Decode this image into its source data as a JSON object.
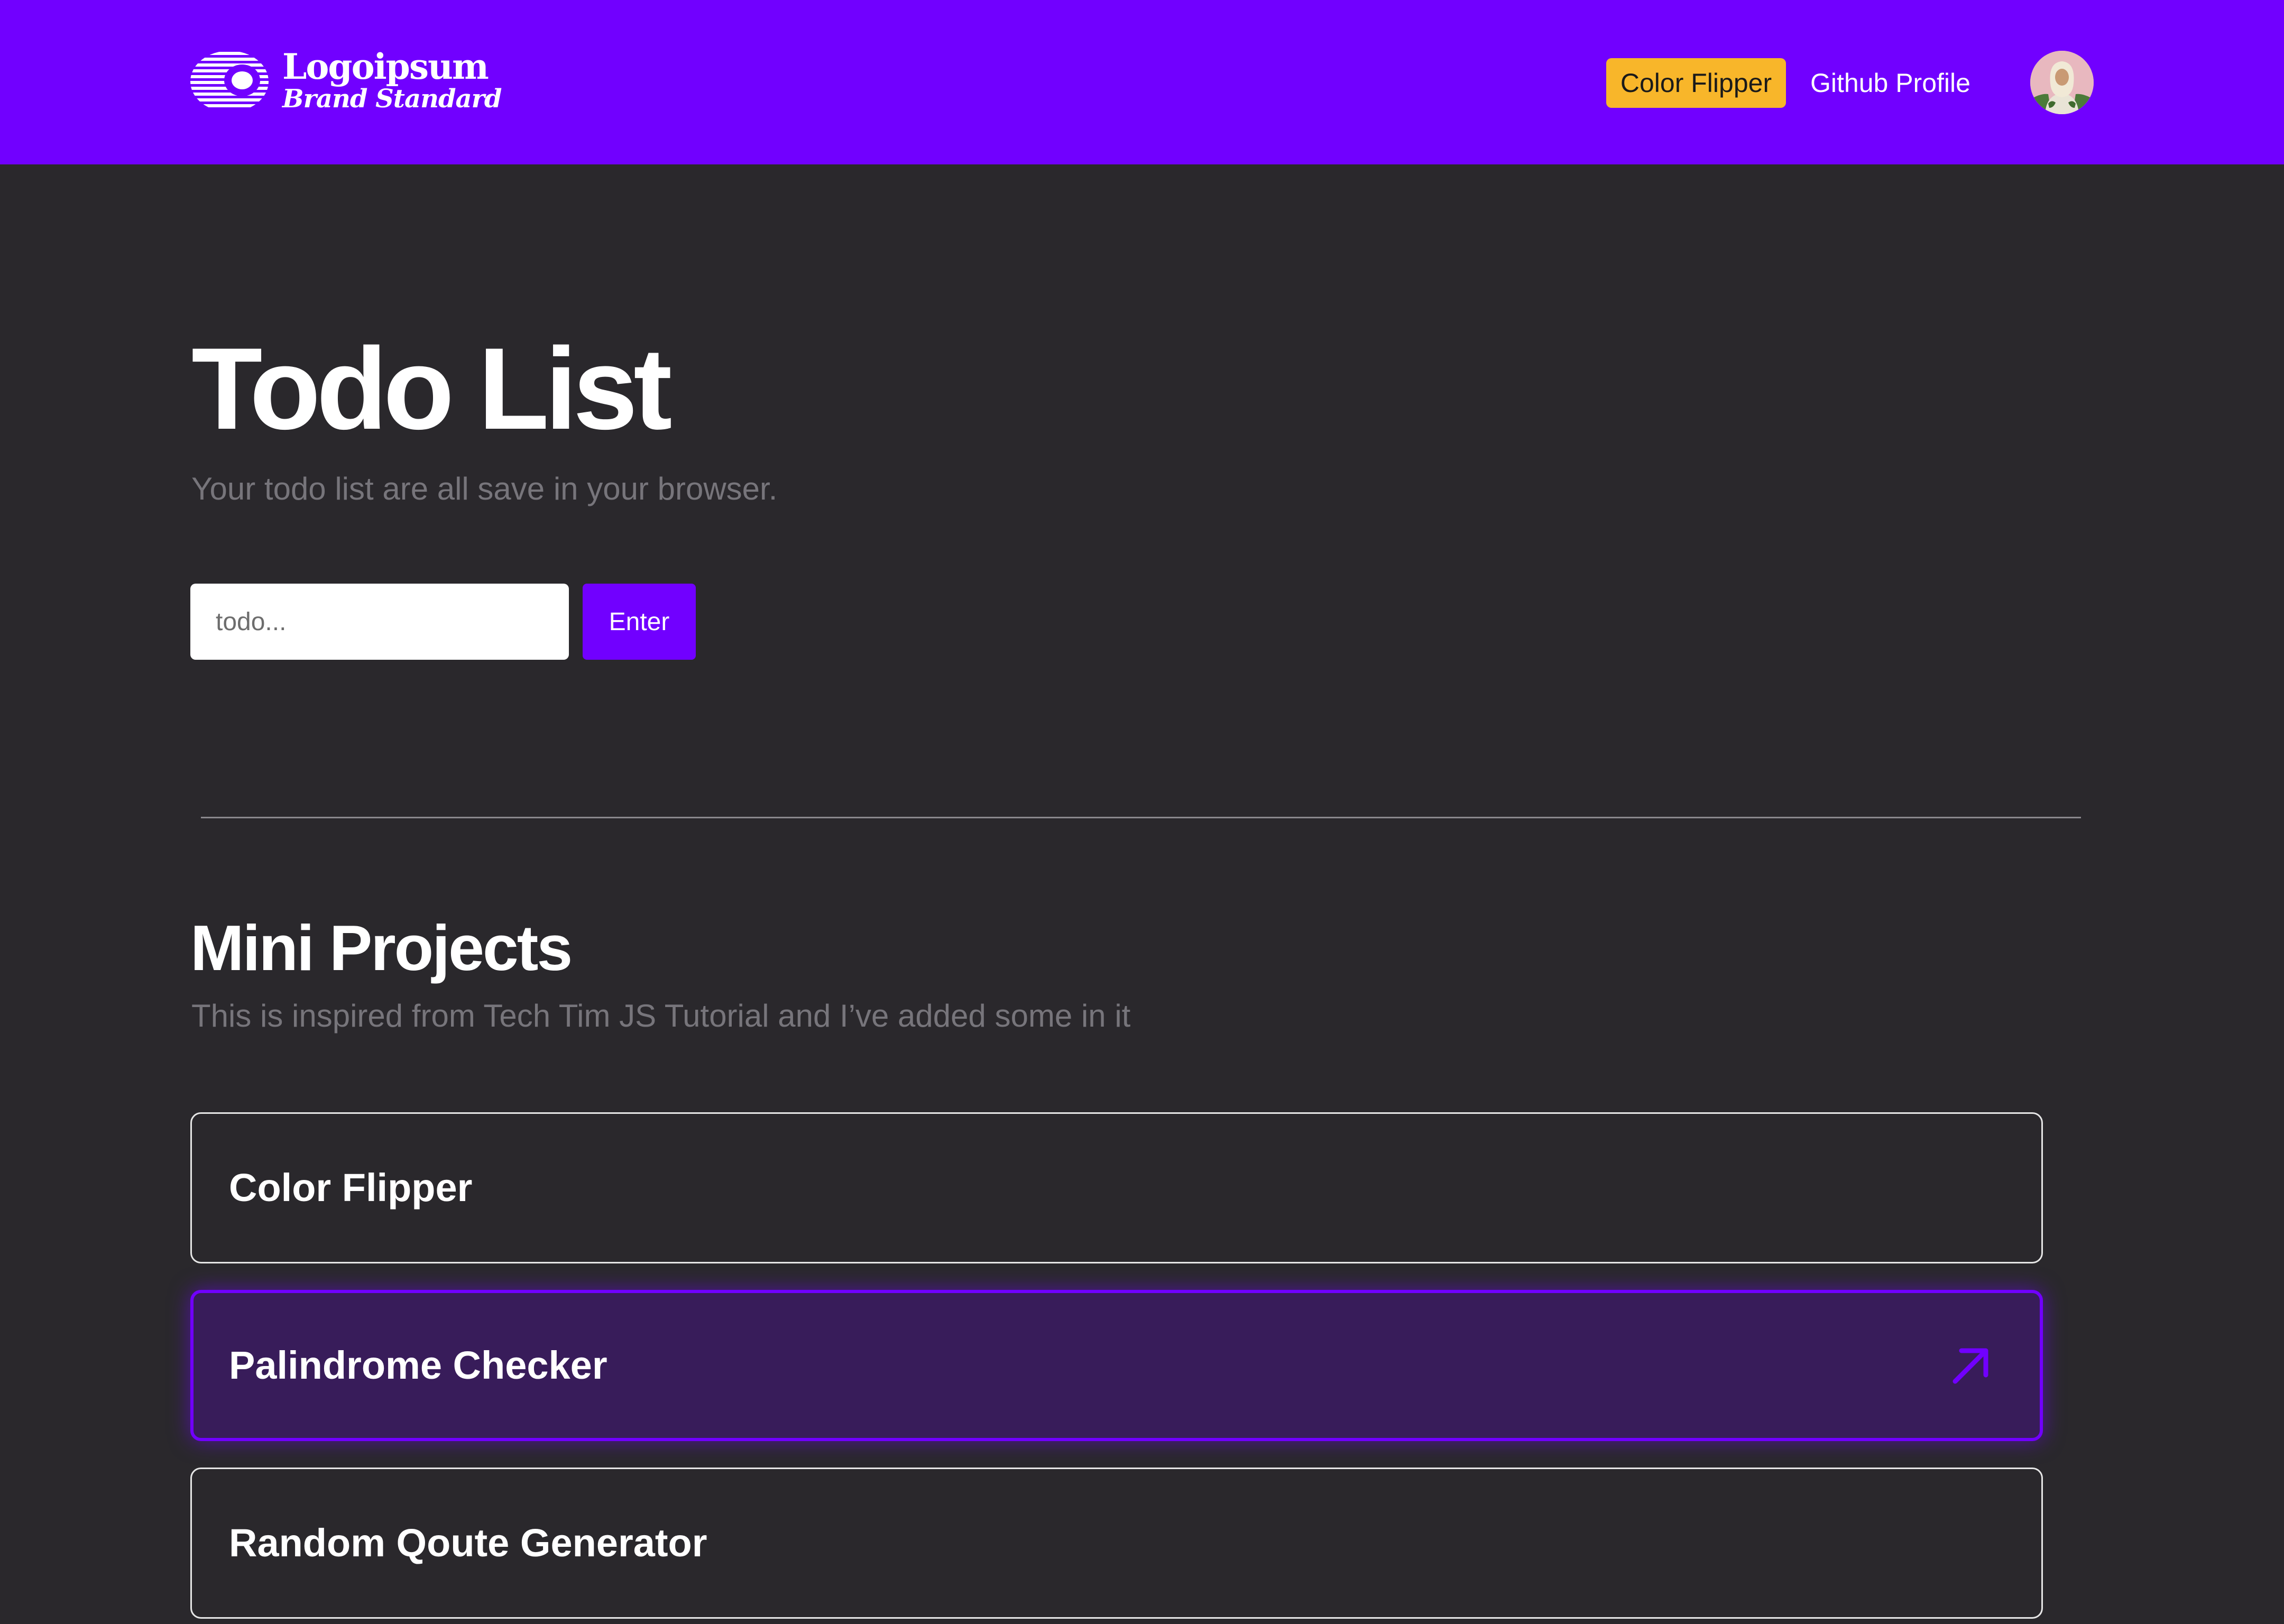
{
  "header": {
    "logo": {
      "name": "Logoipsum",
      "tagline": "Brand Standard"
    },
    "nav": {
      "color_flipper_label": "Color Flipper",
      "github_label": "Github Profile"
    },
    "avatar_icon": "user-avatar"
  },
  "hero": {
    "title": "Todo List",
    "subtitle": "Your todo list are all save in your browser.",
    "todo_input": {
      "value": "",
      "placeholder": "todo..."
    },
    "enter_label": "Enter"
  },
  "projects": {
    "title": "Mini Projects",
    "subtitle": "This is inspired from Tech Tim JS Tutorial and I’ve added some in it",
    "items": [
      {
        "label": "Color Flipper",
        "active": false
      },
      {
        "label": "Palindrome Checker",
        "active": true,
        "icon": "arrow-up-right-icon"
      },
      {
        "label": "Random Qoute Generator",
        "active": false
      }
    ]
  },
  "colors": {
    "accent": "#7100ff",
    "highlight": "#f8b62a",
    "background": "#2a282c",
    "muted_text": "#77757b",
    "active_card_bg": "#381c5a"
  }
}
